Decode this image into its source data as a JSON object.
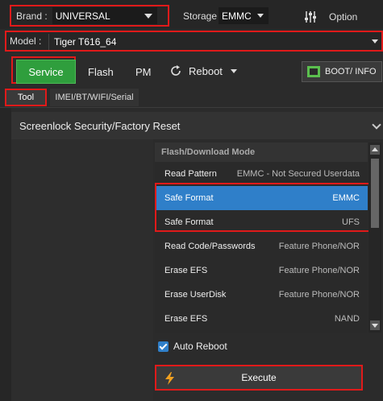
{
  "topbar": {
    "brand_label": "Brand :",
    "brand_value": "UNIVERSAL",
    "storage_label": "Storage",
    "storage_value": "EMMC",
    "option_label": "Option"
  },
  "model": {
    "label": "Model :",
    "value": "Tiger T616_64"
  },
  "tabs": {
    "service": "Service",
    "flash": "Flash",
    "pm": "PM",
    "reboot": "Reboot",
    "boot_info": "BOOT/ INFO"
  },
  "subtabs": {
    "tool": "Tool",
    "imei": "IMEI/BT/WIFI/Serial"
  },
  "section": {
    "title": "Screenlock Security/Factory Reset"
  },
  "list": {
    "header": "Flash/Download Mode",
    "rows": [
      {
        "name": "Read Pattern",
        "value": "EMMC - Not Secured Userdata"
      },
      {
        "name": "Safe Format",
        "value": "EMMC"
      },
      {
        "name": "Safe Format",
        "value": "UFS"
      },
      {
        "name": "Read Code/Passwords",
        "value": "Feature Phone/NOR"
      },
      {
        "name": "Erase EFS",
        "value": "Feature Phone/NOR"
      },
      {
        "name": "Erase UserDisk",
        "value": "Feature Phone/NOR"
      },
      {
        "name": "Erase EFS",
        "value": "NAND"
      }
    ]
  },
  "auto_reboot": {
    "label": "Auto Reboot",
    "checked": true
  },
  "execute": {
    "label": "Execute"
  },
  "colors": {
    "accent_green": "#2f9e3d",
    "selection_blue": "#2f7fc9",
    "highlight_red": "#e01a1a"
  }
}
